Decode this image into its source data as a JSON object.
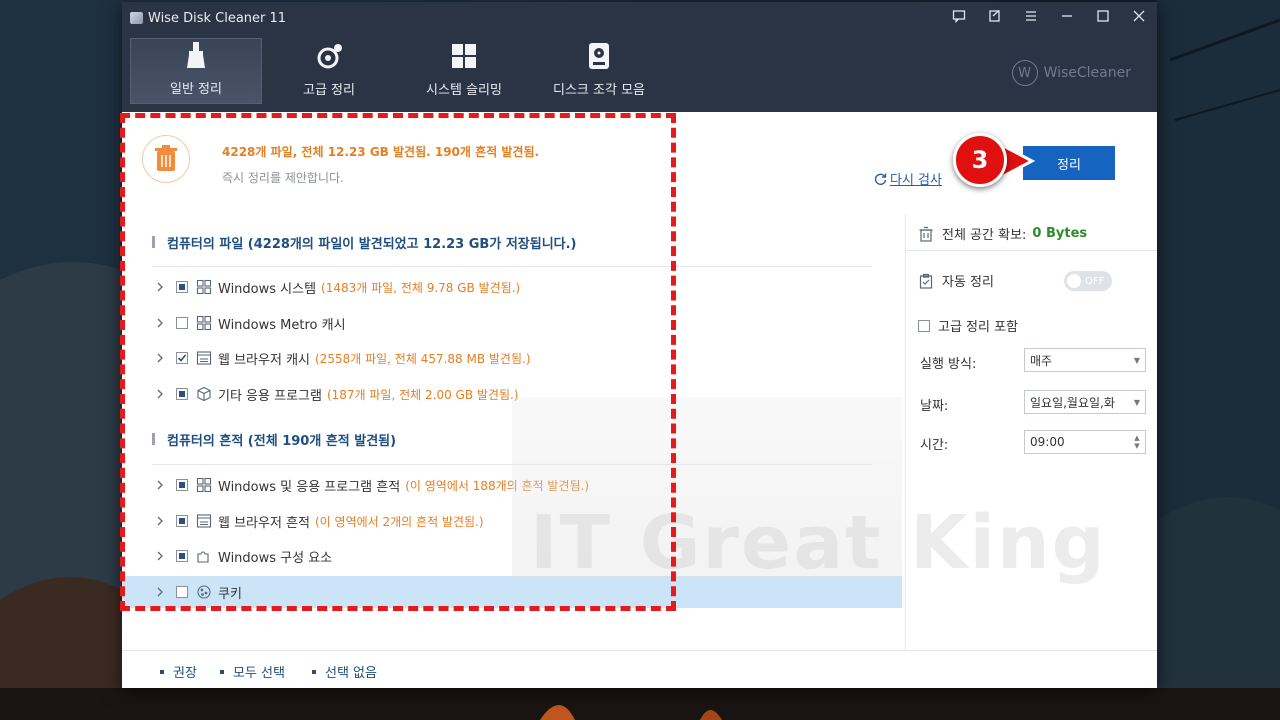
{
  "window": {
    "title": "Wise Disk Cleaner 11",
    "brand": "WiseCleaner"
  },
  "tabs": [
    {
      "label": "일반 정리",
      "icon": "broom-icon",
      "active": true
    },
    {
      "label": "고급 정리",
      "icon": "advanced-clean-icon",
      "active": false
    },
    {
      "label": "시스템 슬리밍",
      "icon": "windows-icon",
      "active": false
    },
    {
      "label": "디스크 조각 모음",
      "icon": "disk-defrag-icon",
      "active": false
    }
  ],
  "summary": {
    "main": "4228개 파일, 전체 12.23 GB 발견됨. 190개 흔적 발견됨.",
    "sub": "즉시 정리를 제안합니다.",
    "rescan": "다시 검사",
    "clean_button": "정리"
  },
  "sections": [
    {
      "title": "컴퓨터의 파일 (4228개의 파일이 발견되었고 12.23 GB가 저장됩니다.)",
      "items": [
        {
          "name": "Windows 시스템",
          "note": "(1483개 파일, 전체 9.78 GB 발견됨.)",
          "check": "partial",
          "icon": "windows-grid-icon"
        },
        {
          "name": "Windows Metro 캐시",
          "note": "",
          "check": "unchecked",
          "icon": "windows-grid-icon"
        },
        {
          "name": "웹 브라우저 캐시",
          "note": "(2558개 파일, 전체 457.88 MB 발견됨.)",
          "check": "checked",
          "icon": "browser-icon"
        },
        {
          "name": "기타 응용 프로그램",
          "note": "(187개 파일, 전체 2.00 GB 발견됨.)",
          "check": "partial",
          "icon": "package-icon"
        }
      ]
    },
    {
      "title": "컴퓨터의 흔적 (전체 190개 흔적 발견됨)",
      "items": [
        {
          "name": "Windows 및 응용 프로그램 흔적",
          "note": "(이 영역에서 188개의 흔적 발견됨.)",
          "check": "partial",
          "icon": "windows-grid-icon"
        },
        {
          "name": "웹 브라우저 흔적",
          "note": "(이 영역에서 2개의 흔적 발견됨.)",
          "check": "partial",
          "icon": "browser-icon"
        },
        {
          "name": "Windows 구성 요소",
          "note": "",
          "check": "partial",
          "icon": "puzzle-icon"
        },
        {
          "name": "쿠키",
          "note": "",
          "check": "unchecked",
          "icon": "cookie-icon"
        }
      ]
    }
  ],
  "right_panel": {
    "space_label": "전체 공간 확보:",
    "space_value": "0 Bytes",
    "auto_clean": "자동 정리",
    "toggle_state": "OFF",
    "include_advanced": "고급 정리 포함",
    "run_mode_label": "실행 방식:",
    "run_mode_value": "매주",
    "date_label": "날짜:",
    "date_value": "일요일,월요일,화",
    "time_label": "시간:",
    "time_value": "09:00"
  },
  "footer": {
    "recommend": "권장",
    "select_all": "모두 선택",
    "select_none": "선택 없음"
  },
  "overlay": {
    "step_number": "3",
    "watermark": "IT Great King"
  },
  "colors": {
    "titlebar": "#2b3445",
    "accent_blue": "#1565c0",
    "orange_note": "#e67e22",
    "marker_red": "#e01010"
  }
}
